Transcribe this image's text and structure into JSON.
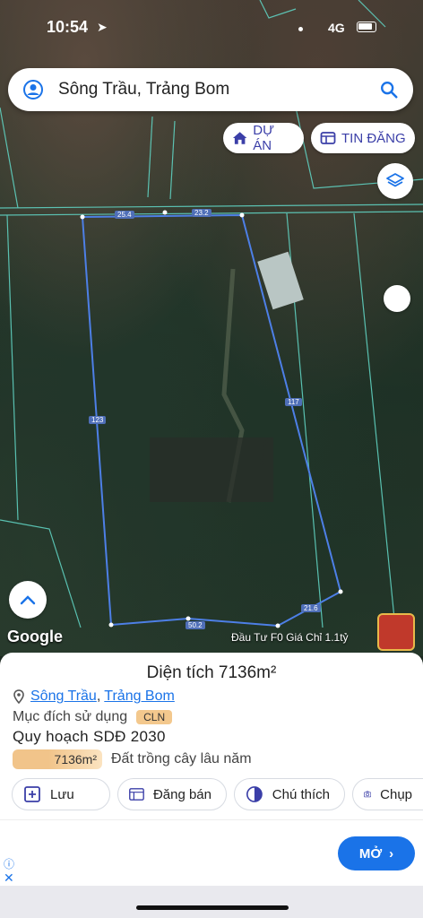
{
  "status": {
    "time": "10:54",
    "network": "4G"
  },
  "search": {
    "query": "Sông Trầu, Trảng Bom"
  },
  "chips": {
    "du_an": "DỰ ÁN",
    "tin_dang": "TIN ĐĂNG"
  },
  "map": {
    "edge_labels": [
      "25.4",
      "23.2",
      "123",
      "117",
      "50.2",
      "21.6"
    ],
    "google": "Google",
    "promo": "Đầu Tư F0 Giá Chỉ 1.1tỷ"
  },
  "panel": {
    "area_title": "Diện tích 7136m²",
    "location_a": "Sông Trầu",
    "location_b": "Trảng Bom",
    "purpose_label": "Mục đích sử dụng",
    "purpose_code": "CLN",
    "plan_title": "Quy hoạch SDĐ 2030",
    "plan_area": "7136m²",
    "plan_desc": "Đất trồng cây lâu năm",
    "actions": [
      "Lưu",
      "Đăng bán",
      "Chú thích",
      "Chụp"
    ]
  },
  "ad": {
    "button": "MỞ",
    "info": "ⓘ",
    "close": "✕"
  }
}
